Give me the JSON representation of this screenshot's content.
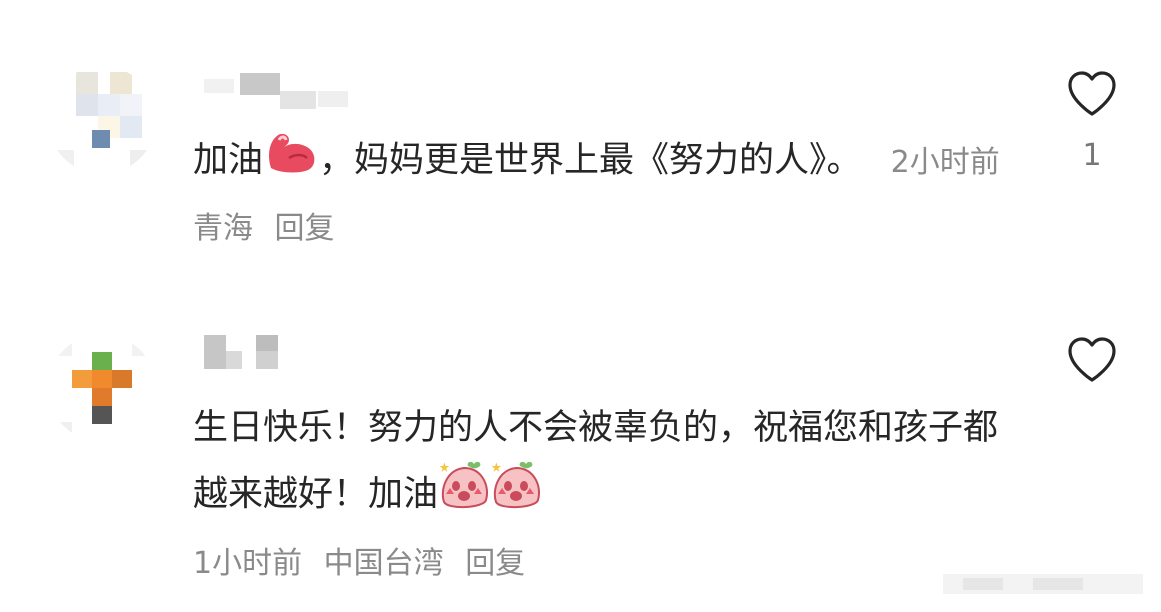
{
  "comments": [
    {
      "text_before": "加油",
      "emoji": "flexed-biceps",
      "text_after": "，妈妈更是世界上最《努力的人》。",
      "time": "2小时前",
      "location": "青海",
      "reply_label": "回复",
      "likes": "1"
    },
    {
      "text_before": "生日快乐！努力的人不会被辜负的，祝福您和孩子都越来越好！加油",
      "emoji": "cheering-face",
      "time": "1小时前",
      "location": "中国台湾",
      "reply_label": "回复",
      "likes": ""
    }
  ],
  "icons": {
    "like": "heart-outline-icon"
  },
  "colors": {
    "meta_text": "#8a8a8a",
    "body_text": "#262626",
    "accent_pink": "#f06a7a"
  }
}
